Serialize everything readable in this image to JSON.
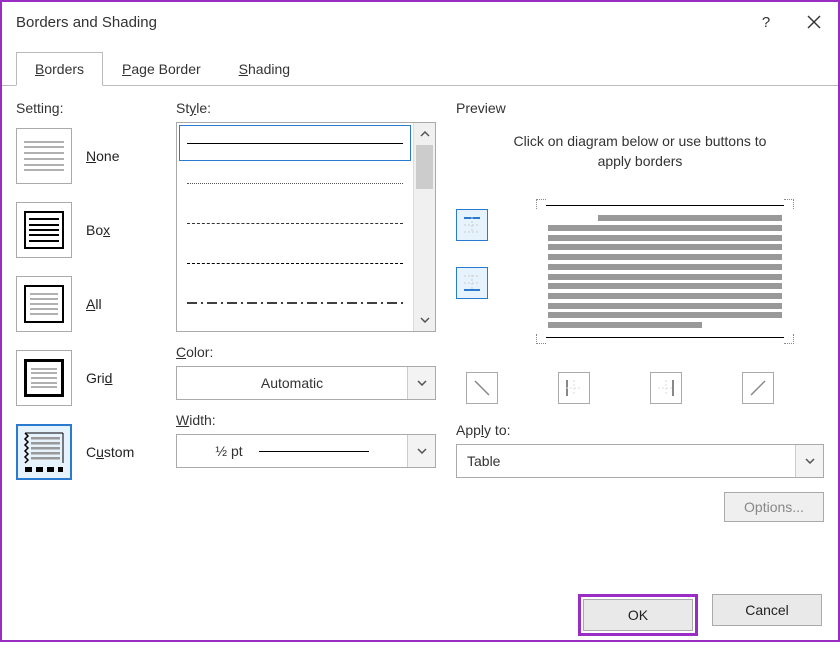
{
  "window": {
    "title": "Borders and Shading",
    "help": "?",
    "close": "✕"
  },
  "tabs": [
    {
      "label": "Borders",
      "u_index": 0,
      "active": true
    },
    {
      "label": "Page Border",
      "u_index": 0,
      "active": false
    },
    {
      "label": "Shading",
      "u_index": 0,
      "active": false
    }
  ],
  "setting": {
    "label": "Setting:",
    "options": [
      {
        "key": "none",
        "label": "None",
        "u": "N"
      },
      {
        "key": "box",
        "label": "Box",
        "u": "x",
        "pre": "Bo"
      },
      {
        "key": "all",
        "label": "All",
        "u": "A"
      },
      {
        "key": "grid",
        "label": "Grid",
        "u": "d",
        "pre": "Gri"
      },
      {
        "key": "custom",
        "label": "Custom",
        "u": "u",
        "pre": "C",
        "post": "stom",
        "selected": true
      }
    ]
  },
  "style": {
    "label": "Style:",
    "u": "y",
    "pre": "St",
    "post": "le:"
  },
  "color": {
    "label": "Color:",
    "u": "C",
    "post": "olor:",
    "value": "Automatic"
  },
  "width": {
    "label": "Width:",
    "u": "W",
    "post": "idth:",
    "value": "½ pt"
  },
  "preview": {
    "label": "Preview",
    "hint": "Click on diagram below or use buttons to apply borders"
  },
  "apply": {
    "label": "Apply to:",
    "u": "l",
    "pre": "App",
    "post": "y to:",
    "value": "Table"
  },
  "buttons": {
    "options": "Options...",
    "ok": "OK",
    "cancel": "Cancel"
  }
}
